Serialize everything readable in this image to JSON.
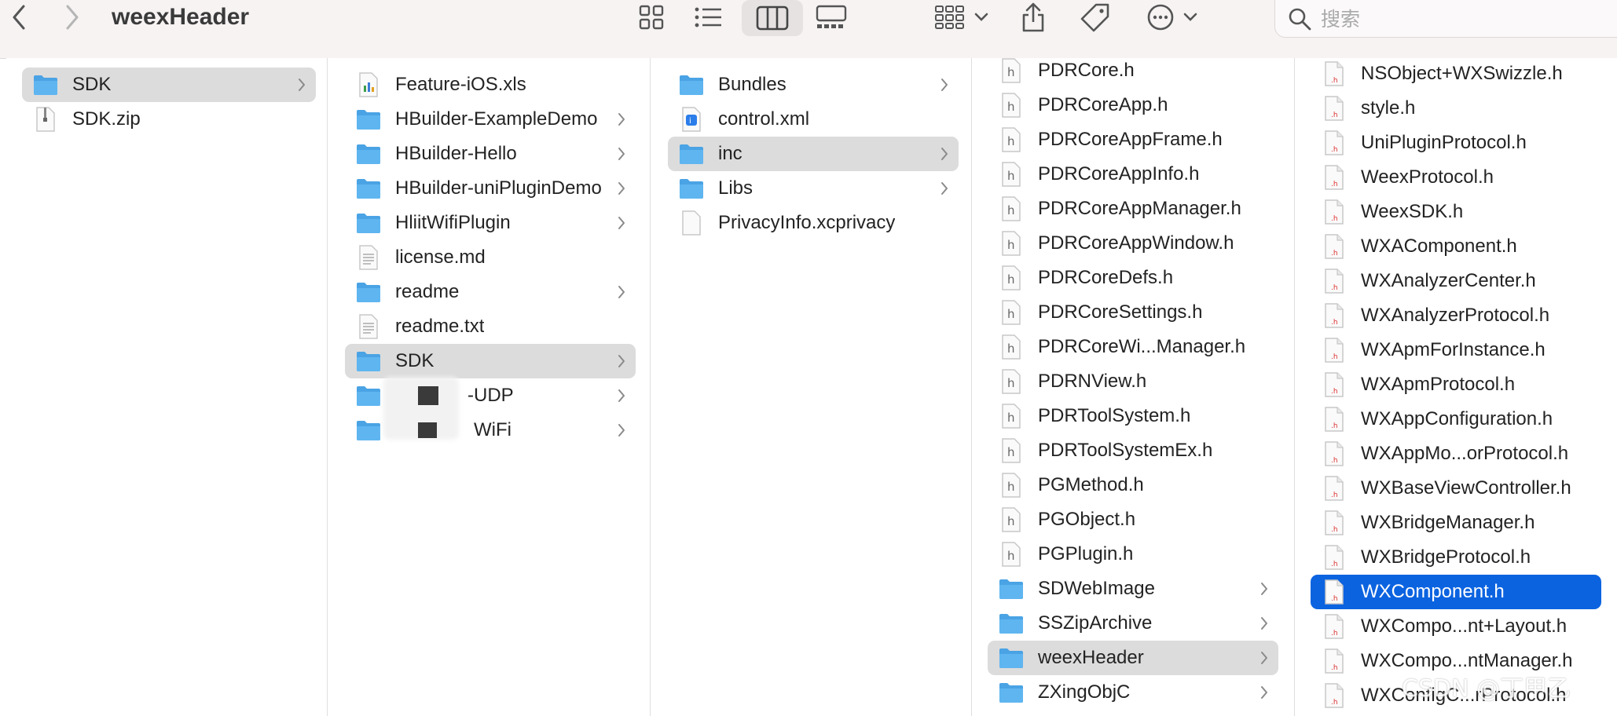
{
  "window": {
    "title": "weexHeader"
  },
  "toolbar": {
    "search_placeholder": "搜索",
    "icons": [
      "chevron-left-icon",
      "chevron-right-icon",
      "grid-view-icon",
      "list-view-icon",
      "column-view-icon",
      "gallery-view-icon",
      "group-icon",
      "share-icon",
      "tag-icon",
      "more-icon",
      "search-icon"
    ]
  },
  "colors": {
    "selection_active": "#0b63e0",
    "selection_inactive": "#dcdcdc",
    "folder": "#5fb5f0",
    "toolbar_bg": "#f7f3f3"
  },
  "columns": [
    {
      "items": [
        {
          "name": "SDK",
          "kind": "folder",
          "selected": true
        },
        {
          "name": "SDK.zip",
          "kind": "zip"
        }
      ]
    },
    {
      "items": [
        {
          "name": "Feature-iOS.xls",
          "kind": "xls"
        },
        {
          "name": "HBuilder-ExampleDemo",
          "kind": "folder"
        },
        {
          "name": "HBuilder-Hello",
          "kind": "folder"
        },
        {
          "name": "HBuilder-uniPluginDemo",
          "kind": "folder"
        },
        {
          "name": "HliitWifiPlugin",
          "kind": "folder"
        },
        {
          "name": "license.md",
          "kind": "doc"
        },
        {
          "name": "readme",
          "kind": "folder"
        },
        {
          "name": "readme.txt",
          "kind": "doc"
        },
        {
          "name": "SDK",
          "kind": "folder",
          "selected": true
        },
        {
          "name": "-UDP",
          "kind": "folder",
          "redacted": true
        },
        {
          "name": "WiFi",
          "kind": "folder",
          "redacted": true
        }
      ]
    },
    {
      "items": [
        {
          "name": "Bundles",
          "kind": "folder"
        },
        {
          "name": "control.xml",
          "kind": "xml"
        },
        {
          "name": "inc",
          "kind": "folder",
          "selected": true
        },
        {
          "name": "Libs",
          "kind": "folder"
        },
        {
          "name": "PrivacyInfo.xcprivacy",
          "kind": "blank"
        }
      ]
    },
    {
      "items": [
        {
          "name": "PDRCore.h",
          "kind": "h"
        },
        {
          "name": "PDRCoreApp.h",
          "kind": "h"
        },
        {
          "name": "PDRCoreAppFrame.h",
          "kind": "h"
        },
        {
          "name": "PDRCoreAppInfo.h",
          "kind": "h"
        },
        {
          "name": "PDRCoreAppManager.h",
          "kind": "h"
        },
        {
          "name": "PDRCoreAppWindow.h",
          "kind": "h"
        },
        {
          "name": "PDRCoreDefs.h",
          "kind": "h"
        },
        {
          "name": "PDRCoreSettings.h",
          "kind": "h"
        },
        {
          "name": "PDRCoreWi...Manager.h",
          "kind": "h"
        },
        {
          "name": "PDRNView.h",
          "kind": "h"
        },
        {
          "name": "PDRToolSystem.h",
          "kind": "h"
        },
        {
          "name": "PDRToolSystemEx.h",
          "kind": "h"
        },
        {
          "name": "PGMethod.h",
          "kind": "h"
        },
        {
          "name": "PGObject.h",
          "kind": "h"
        },
        {
          "name": "PGPlugin.h",
          "kind": "h"
        },
        {
          "name": "SDWebImage",
          "kind": "folder"
        },
        {
          "name": "SSZipArchive",
          "kind": "folder"
        },
        {
          "name": "weexHeader",
          "kind": "folder",
          "selected": true
        },
        {
          "name": "ZXingObjC",
          "kind": "folder"
        }
      ]
    },
    {
      "items": [
        {
          "name": "NSObject+WXSwizzle.h",
          "kind": "hred"
        },
        {
          "name": "style.h",
          "kind": "hred"
        },
        {
          "name": "UniPluginProtocol.h",
          "kind": "hred"
        },
        {
          "name": "WeexProtocol.h",
          "kind": "hred"
        },
        {
          "name": "WeexSDK.h",
          "kind": "hred"
        },
        {
          "name": "WXAComponent.h",
          "kind": "hred"
        },
        {
          "name": "WXAnalyzerCenter.h",
          "kind": "hred"
        },
        {
          "name": "WXAnalyzerProtocol.h",
          "kind": "hred"
        },
        {
          "name": "WXApmForInstance.h",
          "kind": "hred"
        },
        {
          "name": "WXApmProtocol.h",
          "kind": "hred"
        },
        {
          "name": "WXAppConfiguration.h",
          "kind": "hred"
        },
        {
          "name": "WXAppMo...orProtocol.h",
          "kind": "hred"
        },
        {
          "name": "WXBaseViewController.h",
          "kind": "hred"
        },
        {
          "name": "WXBridgeManager.h",
          "kind": "hred"
        },
        {
          "name": "WXBridgeProtocol.h",
          "kind": "hred"
        },
        {
          "name": "WXComponent.h",
          "kind": "hred",
          "active": true
        },
        {
          "name": "WXCompo...nt+Layout.h",
          "kind": "hred"
        },
        {
          "name": "WXCompo...ntManager.h",
          "kind": "hred"
        },
        {
          "name": "WXConfigC...rProtocol.h",
          "kind": "hred"
        }
      ]
    }
  ],
  "watermark": "CSDN @丁甲乙"
}
